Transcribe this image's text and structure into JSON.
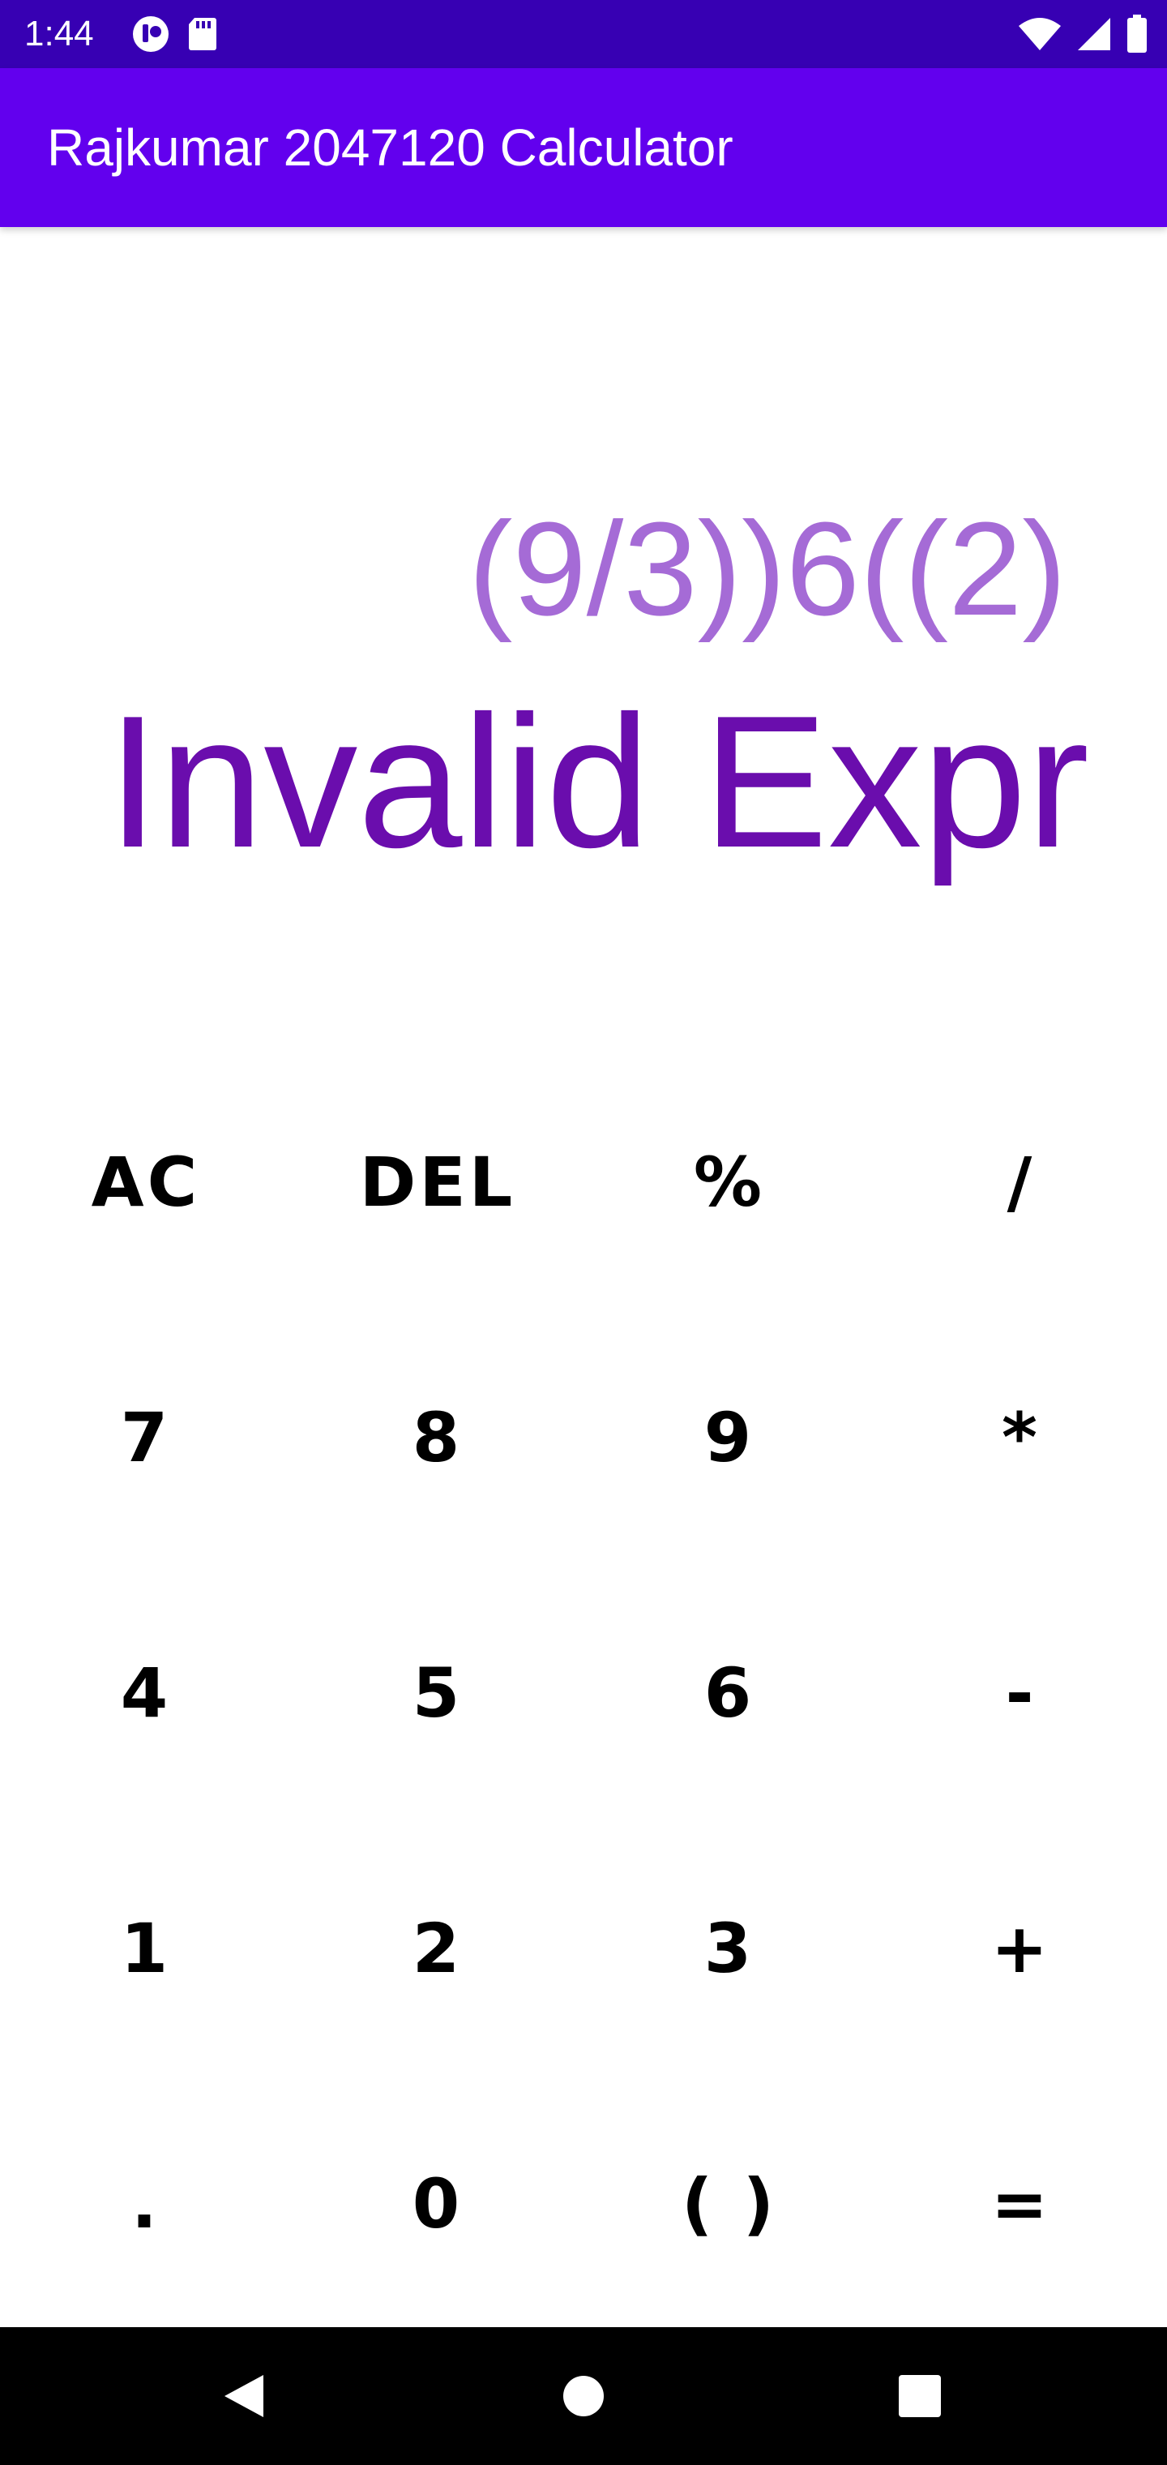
{
  "status_bar": {
    "time": "1:44",
    "left_icons": [
      "app-notification-icon",
      "sd-card-icon"
    ],
    "right_icons": [
      "wifi-icon",
      "signal-icon",
      "battery-icon"
    ],
    "background": "#3700b3"
  },
  "app_bar": {
    "title": "Rajkumar 2047120 Calculator",
    "background": "#6200ee"
  },
  "display": {
    "expression": "(9/3))6((2)",
    "result": "Invalid Expr",
    "expression_color": "#a56bd6",
    "result_color": "#6a0dad"
  },
  "keypad": {
    "keys": [
      "AC",
      "DEL",
      "%",
      "/",
      "7",
      "8",
      "9",
      "*",
      "4",
      "5",
      "6",
      "-",
      "1",
      "2",
      "3",
      "+",
      ".",
      "0",
      "( )",
      "="
    ]
  },
  "nav_bar": {
    "icons": [
      "back-icon",
      "home-icon",
      "recents-icon"
    ]
  }
}
